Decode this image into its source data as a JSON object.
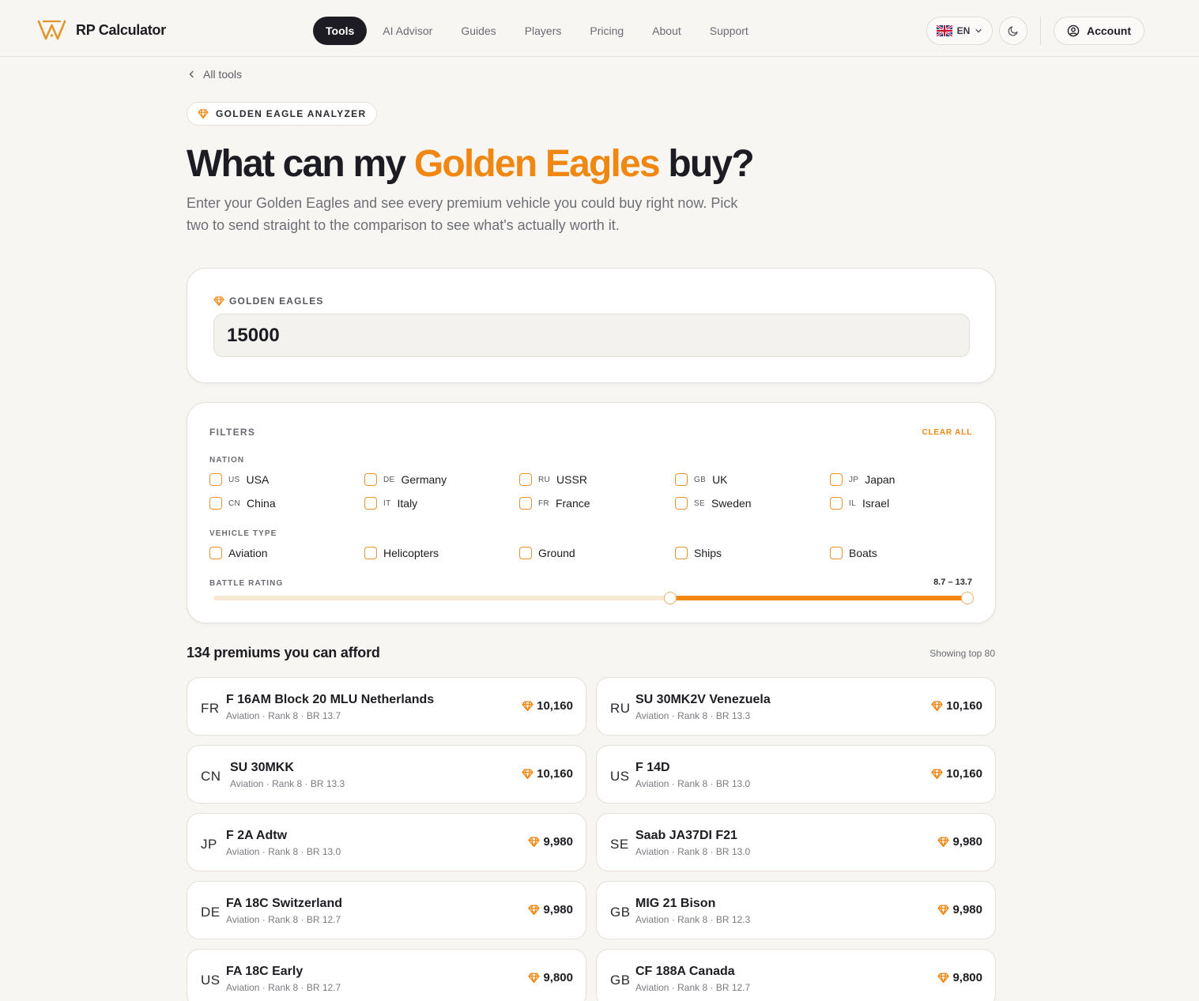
{
  "header": {
    "brand": "RP Calculator",
    "nav": [
      {
        "label": "Tools",
        "active": true
      },
      {
        "label": "AI Advisor"
      },
      {
        "label": "Guides"
      },
      {
        "label": "Players"
      },
      {
        "label": "Pricing"
      },
      {
        "label": "About"
      },
      {
        "label": "Support"
      }
    ],
    "language": "EN",
    "account_label": "Account"
  },
  "back_link": "All tools",
  "badge": "GOLDEN EAGLE ANALYZER",
  "hero": {
    "title_pre": "What can my ",
    "title_accent": "Golden Eagles",
    "title_post": " buy?",
    "subtitle": "Enter your Golden Eagles and see every premium vehicle you could buy right now. Pick two to send straight to the comparison to see what's actually worth it."
  },
  "golden_eagles": {
    "label": "GOLDEN EAGLES",
    "value": "15000"
  },
  "filters": {
    "title": "FILTERS",
    "clear_label": "CLEAR ALL",
    "nation_label": "NATION",
    "nations": [
      {
        "code": "US",
        "name": "USA"
      },
      {
        "code": "DE",
        "name": "Germany"
      },
      {
        "code": "RU",
        "name": "USSR"
      },
      {
        "code": "GB",
        "name": "UK"
      },
      {
        "code": "JP",
        "name": "Japan"
      },
      {
        "code": "CN",
        "name": "China"
      },
      {
        "code": "IT",
        "name": "Italy"
      },
      {
        "code": "FR",
        "name": "France"
      },
      {
        "code": "SE",
        "name": "Sweden"
      },
      {
        "code": "IL",
        "name": "Israel"
      }
    ],
    "vehicle_type_label": "VEHICLE TYPE",
    "vehicle_types": [
      "Aviation",
      "Helicopters",
      "Ground",
      "Ships",
      "Boats"
    ],
    "br_label": "BATTLE RATING",
    "br_value": "8.7 – 13.7",
    "br_range": [
      1.0,
      13.7
    ],
    "br_selected": [
      8.7,
      13.7
    ]
  },
  "results": {
    "title": "134 premiums you can afford",
    "note": "Showing top 80",
    "items": [
      {
        "code": "FR",
        "name": "F 16AM Block 20 MLU Netherlands",
        "meta": "Aviation · Rank 8 · BR 13.7",
        "price": "10,160"
      },
      {
        "code": "RU",
        "name": "SU 30MK2V Venezuela",
        "meta": "Aviation · Rank 8 · BR 13.3",
        "price": "10,160"
      },
      {
        "code": "CN",
        "name": "SU 30MKK",
        "meta": "Aviation · Rank 8 · BR 13.3",
        "price": "10,160"
      },
      {
        "code": "US",
        "name": "F 14D",
        "meta": "Aviation · Rank 8 · BR 13.0",
        "price": "10,160"
      },
      {
        "code": "JP",
        "name": "F 2A Adtw",
        "meta": "Aviation · Rank 8 · BR 13.0",
        "price": "9,980"
      },
      {
        "code": "SE",
        "name": "Saab JA37DI F21",
        "meta": "Aviation · Rank 8 · BR 13.0",
        "price": "9,980"
      },
      {
        "code": "DE",
        "name": "FA 18C Switzerland",
        "meta": "Aviation · Rank 8 · BR 12.7",
        "price": "9,980"
      },
      {
        "code": "GB",
        "name": "MIG 21 Bison",
        "meta": "Aviation · Rank 8 · BR 12.3",
        "price": "9,980"
      },
      {
        "code": "US",
        "name": "FA 18C Early",
        "meta": "Aviation · Rank 8 · BR 12.7",
        "price": "9,800"
      },
      {
        "code": "GB",
        "name": "CF 188A Canada",
        "meta": "Aviation · Rank 8 · BR 12.7",
        "price": "9,800"
      }
    ]
  },
  "colors": {
    "accent": "#ef8712",
    "background": "#f7f6f3",
    "text": "#1c1c22"
  }
}
